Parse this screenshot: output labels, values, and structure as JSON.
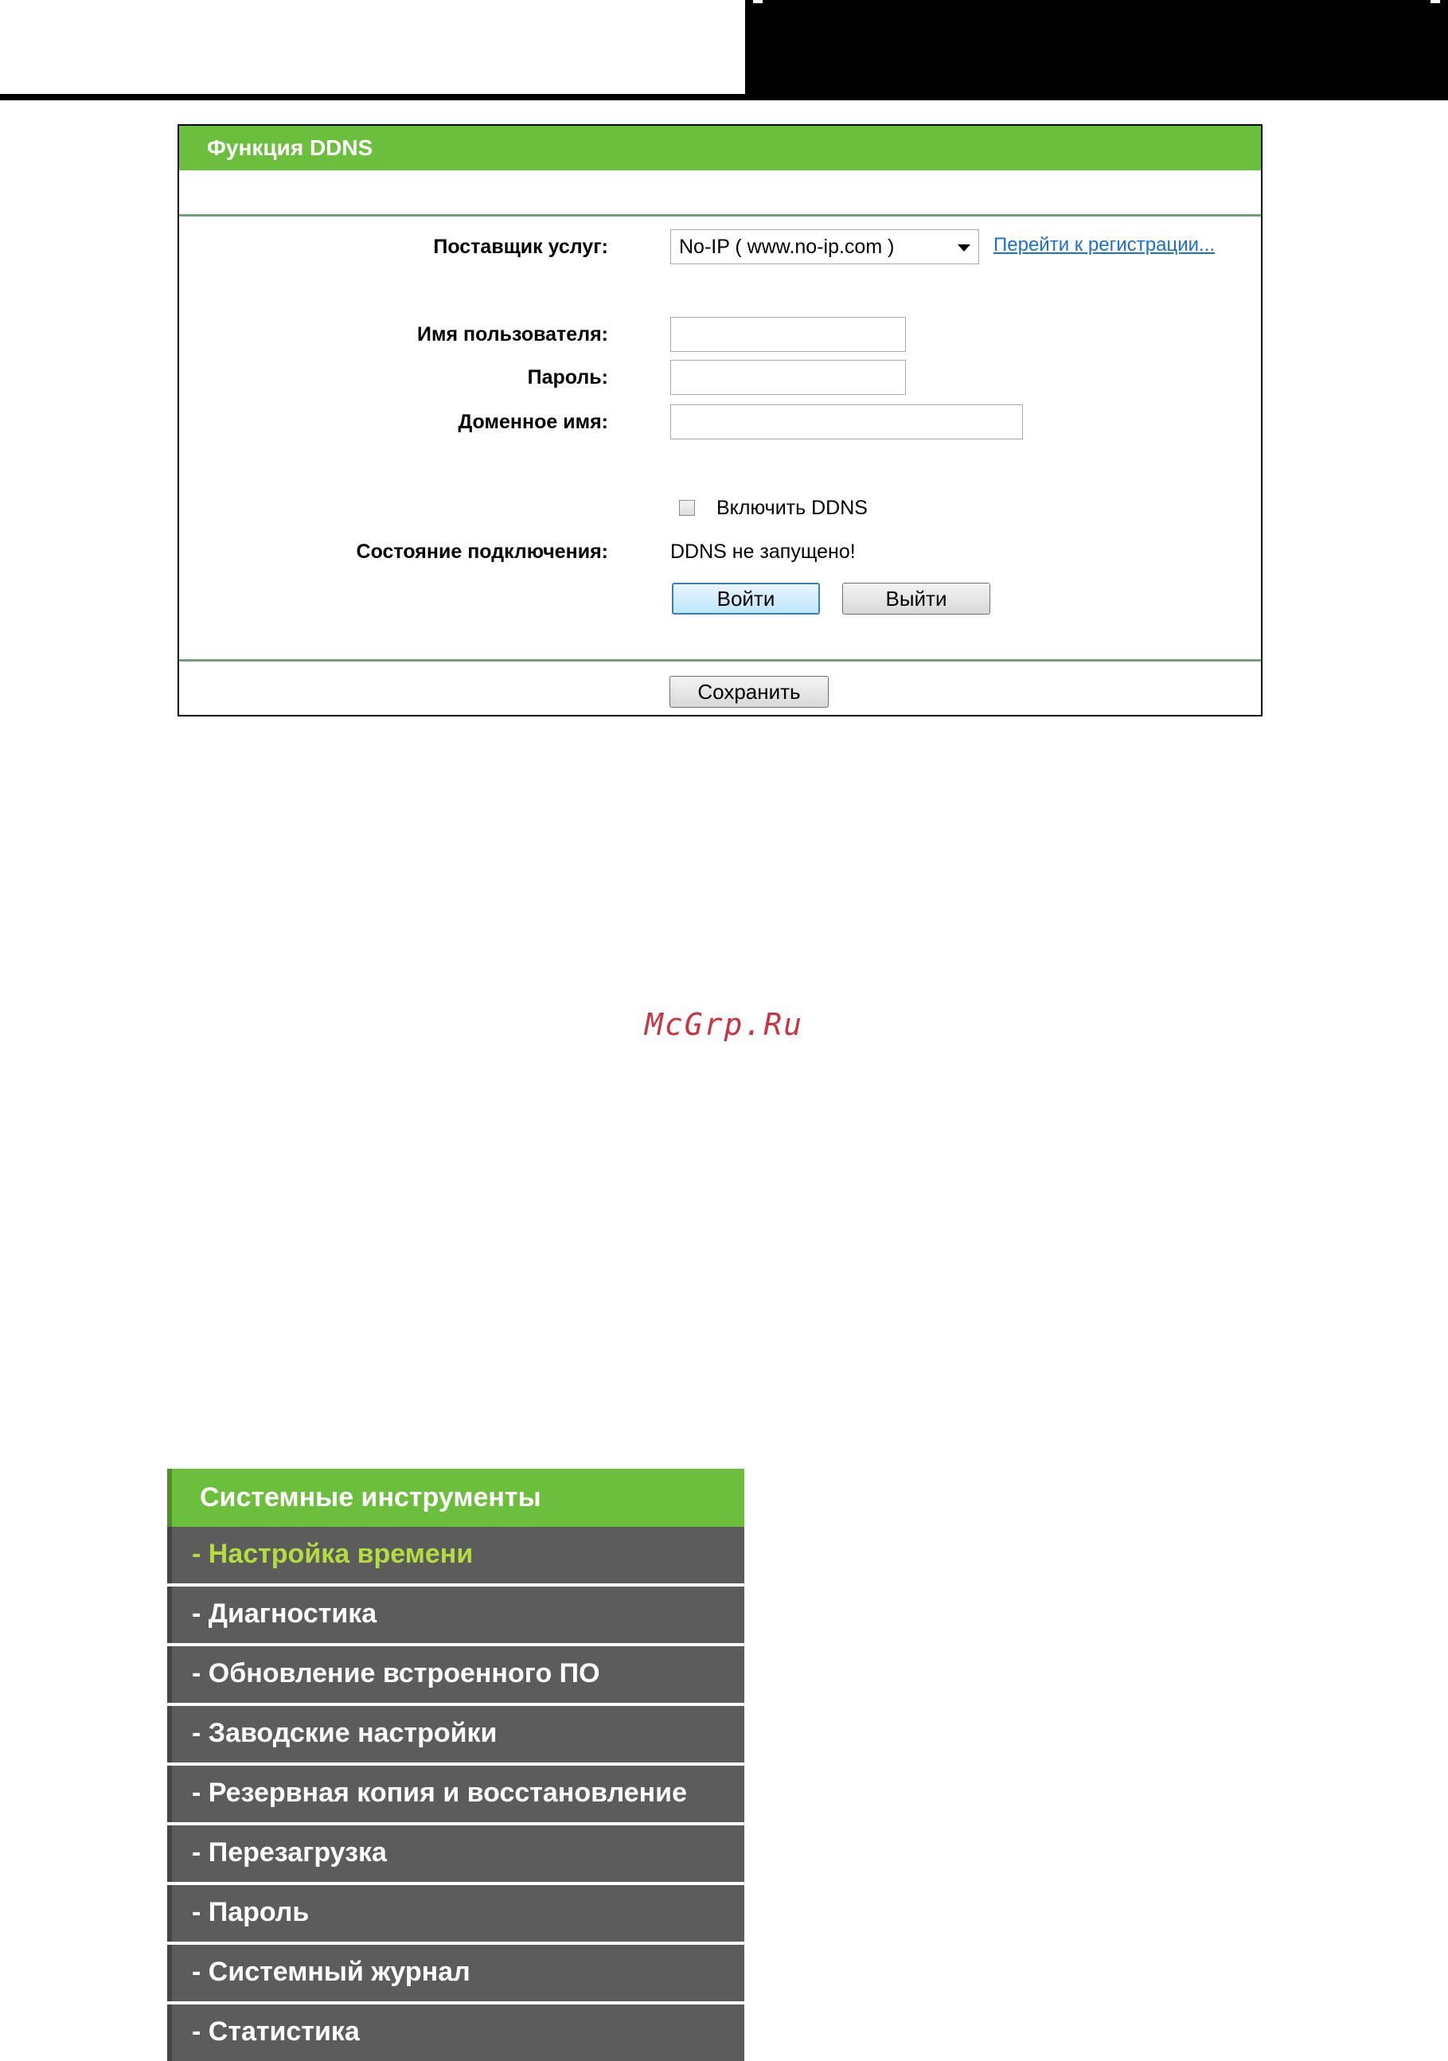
{
  "ddns": {
    "title": "Функция DDNS",
    "provider_label": "Поставщик услуг:",
    "provider_value": "No-IP ( www.no-ip.com )",
    "register_link": "Перейти к регистрации...",
    "username_label": "Имя пользователя:",
    "username_value": "",
    "password_label": "Пароль:",
    "password_value": "",
    "domain_label": "Доменное имя:",
    "domain_value": "",
    "enable_label": "Включить DDNS",
    "enable_checked": false,
    "status_label": "Состояние подключения:",
    "status_value": "DDNS не запущено!",
    "login_button": "Войти",
    "logout_button": "Выйти",
    "save_button": "Сохранить"
  },
  "watermark": "McGrp.Ru",
  "menu": {
    "header": "Системные инструменты",
    "items": [
      {
        "label": "- Настройка времени",
        "active": true
      },
      {
        "label": "- Диагностика",
        "active": false
      },
      {
        "label": "- Обновление встроенного ПО",
        "active": false
      },
      {
        "label": "- Заводские настройки",
        "active": false
      },
      {
        "label": "- Резервная копия и восстановление",
        "active": false
      },
      {
        "label": "- Перезагрузка",
        "active": false
      },
      {
        "label": "- Пароль",
        "active": false
      },
      {
        "label": "- Системный журнал",
        "active": false
      },
      {
        "label": "- Статистика",
        "active": false
      }
    ]
  },
  "colors": {
    "accent_green": "#6cbf3d",
    "menu_bg": "#5c5c5c",
    "menu_active_text": "#b3dc3f",
    "link": "#1a6fd4",
    "watermark": "#c8343f"
  }
}
